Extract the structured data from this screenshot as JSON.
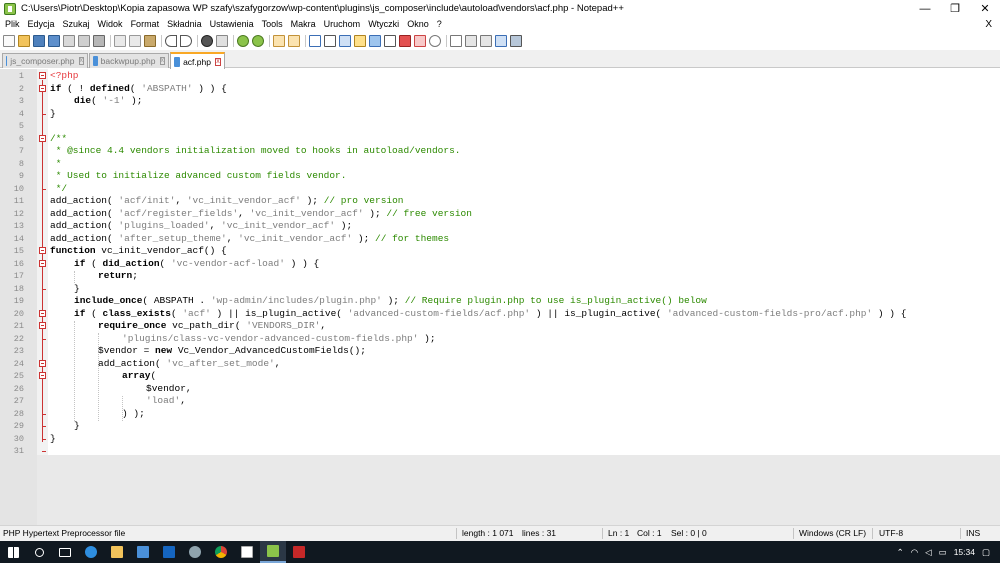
{
  "window": {
    "title": "C:\\Users\\Piotr\\Desktop\\Kopia zapasowa WP szafy\\szafygorzow\\wp-content\\plugins\\js_composer\\include\\autoload\\vendors\\acf.php - Notepad++",
    "minimize": "—",
    "maximize": "❐",
    "close": "✕"
  },
  "menu": {
    "items": [
      "Plik",
      "Edycja",
      "Szukaj",
      "Widok",
      "Format",
      "Składnia",
      "Ustawienia",
      "Tools",
      "Makra",
      "Uruchom",
      "Wtyczki",
      "Okno",
      "?"
    ],
    "close_doc": "X"
  },
  "tabs": [
    {
      "label": "js_composer.php",
      "active": false
    },
    {
      "label": "backwpup.php",
      "active": false
    },
    {
      "label": "acf.php",
      "active": true
    }
  ],
  "editor": {
    "lines": [
      {
        "n": "1"
      },
      {
        "n": "2"
      },
      {
        "n": "3"
      },
      {
        "n": "4"
      },
      {
        "n": "5"
      },
      {
        "n": "6"
      },
      {
        "n": "7"
      },
      {
        "n": "8"
      },
      {
        "n": "9"
      },
      {
        "n": "10"
      },
      {
        "n": "11"
      },
      {
        "n": "12"
      },
      {
        "n": "13"
      },
      {
        "n": "14"
      },
      {
        "n": "15"
      },
      {
        "n": "16"
      },
      {
        "n": "17"
      },
      {
        "n": "18"
      },
      {
        "n": "19"
      },
      {
        "n": "20"
      },
      {
        "n": "21"
      },
      {
        "n": "22"
      },
      {
        "n": "23"
      },
      {
        "n": "24"
      },
      {
        "n": "25"
      },
      {
        "n": "26"
      },
      {
        "n": "27"
      },
      {
        "n": "28"
      },
      {
        "n": "29"
      },
      {
        "n": "30"
      },
      {
        "n": "31"
      }
    ],
    "code": {
      "l1": "<?php",
      "l2a": "if",
      "l2b": " ( ! ",
      "l2c": "defined",
      "l2d": "( ",
      "l2e": "'ABSPATH'",
      "l2f": " ) ) {",
      "l3a": "die",
      "l3b": "( ",
      "l3c": "'-1'",
      "l3d": " );",
      "l4": "}",
      "l6": "/**",
      "l7": " * @since 4.4 vendors initialization moved to hooks in autoload/vendors.",
      "l8": " *",
      "l9": " * Used to initialize advanced custom fields vendor.",
      "l10": " */",
      "l11a": "add_action( ",
      "l11b": "'acf/init'",
      "l11c": ", ",
      "l11d": "'vc_init_vendor_acf'",
      "l11e": " ); ",
      "l11f": "// pro version",
      "l12a": "add_action( ",
      "l12b": "'acf/register_fields'",
      "l12c": ", ",
      "l12d": "'vc_init_vendor_acf'",
      "l12e": " ); ",
      "l12f": "// free version",
      "l13a": "add_action( ",
      "l13b": "'plugins_loaded'",
      "l13c": ", ",
      "l13d": "'vc_init_vendor_acf'",
      "l13e": " );",
      "l14a": "add_action( ",
      "l14b": "'after_setup_theme'",
      "l14c": ", ",
      "l14d": "'vc_init_vendor_acf'",
      "l14e": " ); ",
      "l14f": "// for themes",
      "l15a": "function",
      "l15b": " vc_init_vendor_acf() {",
      "l16a": "if",
      "l16b": " ( ",
      "l16c": "did_action",
      "l16d": "( ",
      "l16e": "'vc-vendor-acf-load'",
      "l16f": " ) ) {",
      "l17a": "return",
      "l17b": ";",
      "l18": "}",
      "l19a": "include_once",
      "l19b": "( ABSPATH . ",
      "l19c": "'wp-admin/includes/plugin.php'",
      "l19d": " ); ",
      "l19e": "// Require plugin.php to use is_plugin_active() below",
      "l20a": "if",
      "l20b": " ( ",
      "l20c": "class_exists",
      "l20d": "( ",
      "l20e": "'acf'",
      "l20f": " ) || is_plugin_active( ",
      "l20g": "'advanced-custom-fields/acf.php'",
      "l20h": " ) || is_plugin_active( ",
      "l20i": "'advanced-custom-fields-pro/acf.php'",
      "l20j": " ) ) {",
      "l21a": "require_once",
      "l21b": " vc_path_dir( ",
      "l21c": "'VENDORS_DIR'",
      "l21d": ",",
      "l22a": "'plugins/class-vc-vendor-advanced-custom-fields.php'",
      "l22b": " );",
      "l23a": "$vendor = ",
      "l23b": "new",
      "l23c": " Vc_Vendor_AdvancedCustomFields();",
      "l24a": "add_action( ",
      "l24b": "'vc_after_set_mode'",
      "l24c": ",",
      "l25a": "array",
      "l25b": "(",
      "l26": "$vendor,",
      "l27a": "'load'",
      "l27b": ",",
      "l28": ") );",
      "l29": "}",
      "l30": "}"
    }
  },
  "status": {
    "filetype": "PHP Hypertext Preprocessor file",
    "length": "length : 1 071",
    "lines": "lines : 31",
    "ln": "Ln : 1",
    "col": "Col : 1",
    "sel": "Sel : 0 | 0",
    "eol": "Windows (CR LF)",
    "encoding": "UTF-8",
    "mode": "INS"
  },
  "taskbar": {
    "time": "15:34"
  },
  "colors": {
    "php_tag": "#e6373b",
    "comment": "#2c8a00",
    "string": "#7d7d7d",
    "fold_marker": "#cc3333",
    "active_tab_accent": "#f9a825",
    "taskbar_bg": "#101820"
  }
}
